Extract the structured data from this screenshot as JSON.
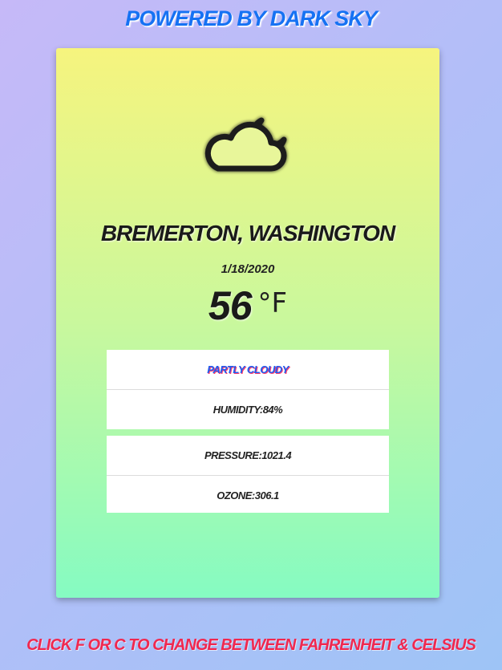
{
  "header": {
    "powered_by": "POWERED BY DARK SKY"
  },
  "weather": {
    "icon": "partly-cloudy-night-icon",
    "location": "BREMERTON, WASHINGTON",
    "date": "1/18/2020",
    "temperature": "56",
    "unit": "°F",
    "summary": "PARTLY CLOUDY",
    "humidity": "HUMIDITY:84%",
    "pressure": "PRESSURE:1021.4",
    "ozone": "OZONE:306.1"
  },
  "footer": {
    "hint": "CLICK F OR C TO CHANGE BETWEEN FAHRENHEIT & CELSIUS"
  },
  "colors": {
    "link": "#1672f3",
    "hint": "#f0284f",
    "card_top": "#f6f47e",
    "card_bottom": "#85fbc2"
  }
}
